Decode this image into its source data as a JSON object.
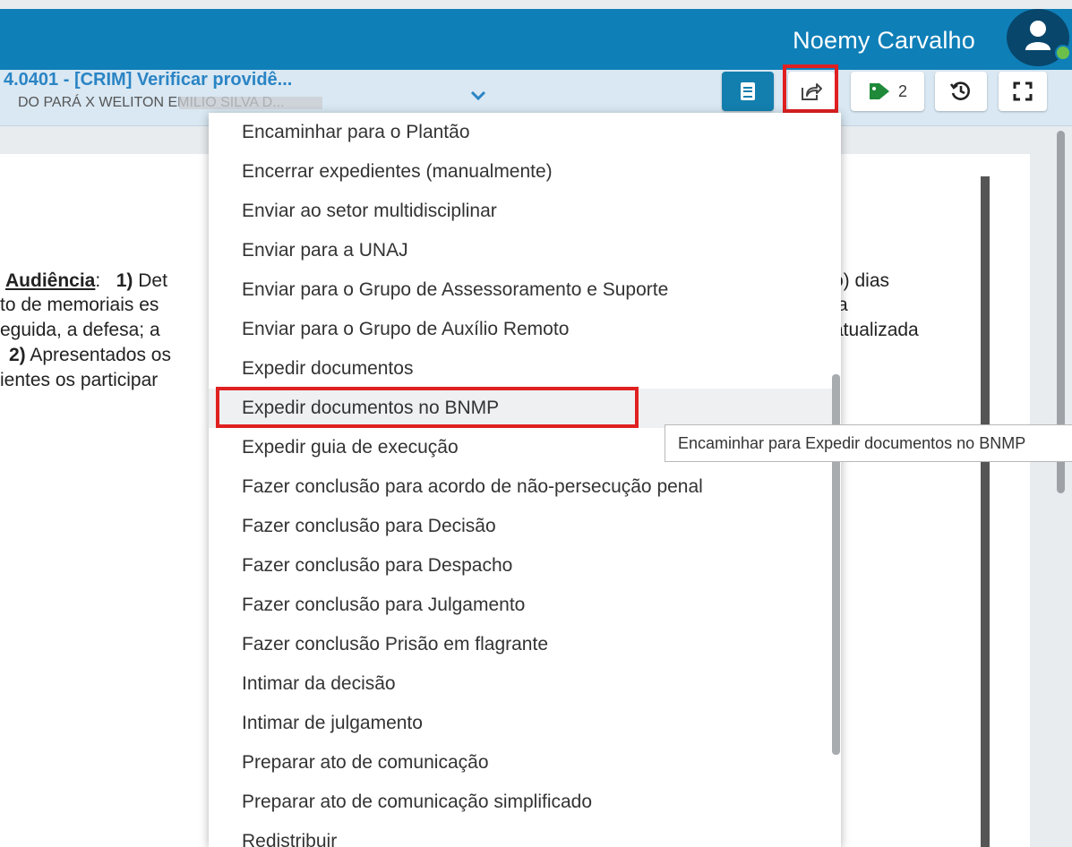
{
  "header": {
    "user_name": "Noemy Carvalho"
  },
  "process": {
    "title": "4.0401 - [CRIM] Verificar providê...",
    "parties": "DO PARÁ X WELITON EMILIO SILVA D..."
  },
  "toolbar": {
    "tag_count": "2"
  },
  "document": {
    "line1_heading": "Audiência",
    "line1_colon": ":",
    "line1_num": "1)",
    "line1_text": "Det",
    "line1_right": "o) dias",
    "line2_text": "to de memoriais es",
    "line2_right": "a",
    "line3_text": "eguida, a defesa; a",
    "line3_right": "atualizada",
    "line4_num": "2)",
    "line4_text": "Apresentados os",
    "line5_text": "ientes os participar"
  },
  "menu": {
    "items": [
      "Encaminhar para o Plantão",
      "Encerrar expedientes (manualmente)",
      "Enviar ao setor multidisciplinar",
      "Enviar para a UNAJ",
      "Enviar para o Grupo de Assessoramento e Suporte",
      "Enviar para o Grupo de Auxílio Remoto",
      "Expedir documentos",
      "Expedir documentos no BNMP",
      "Expedir guia de execução",
      "Fazer conclusão para acordo de não-persecução penal",
      "Fazer conclusão para Decisão",
      "Fazer conclusão para Despacho",
      "Fazer conclusão para Julgamento",
      "Fazer conclusão Prisão em flagrante",
      "Intimar da decisão",
      "Intimar de julgamento",
      "Preparar ato de comunicação",
      "Preparar ato de comunicação simplificado",
      "Redistribuir"
    ]
  },
  "tooltip": {
    "text": "Encaminhar para Expedir documentos no BNMP"
  },
  "colors": {
    "header_bg": "#0f7fb8",
    "highlight_border": "#e02020",
    "tag_green": "#1f8a3a"
  }
}
